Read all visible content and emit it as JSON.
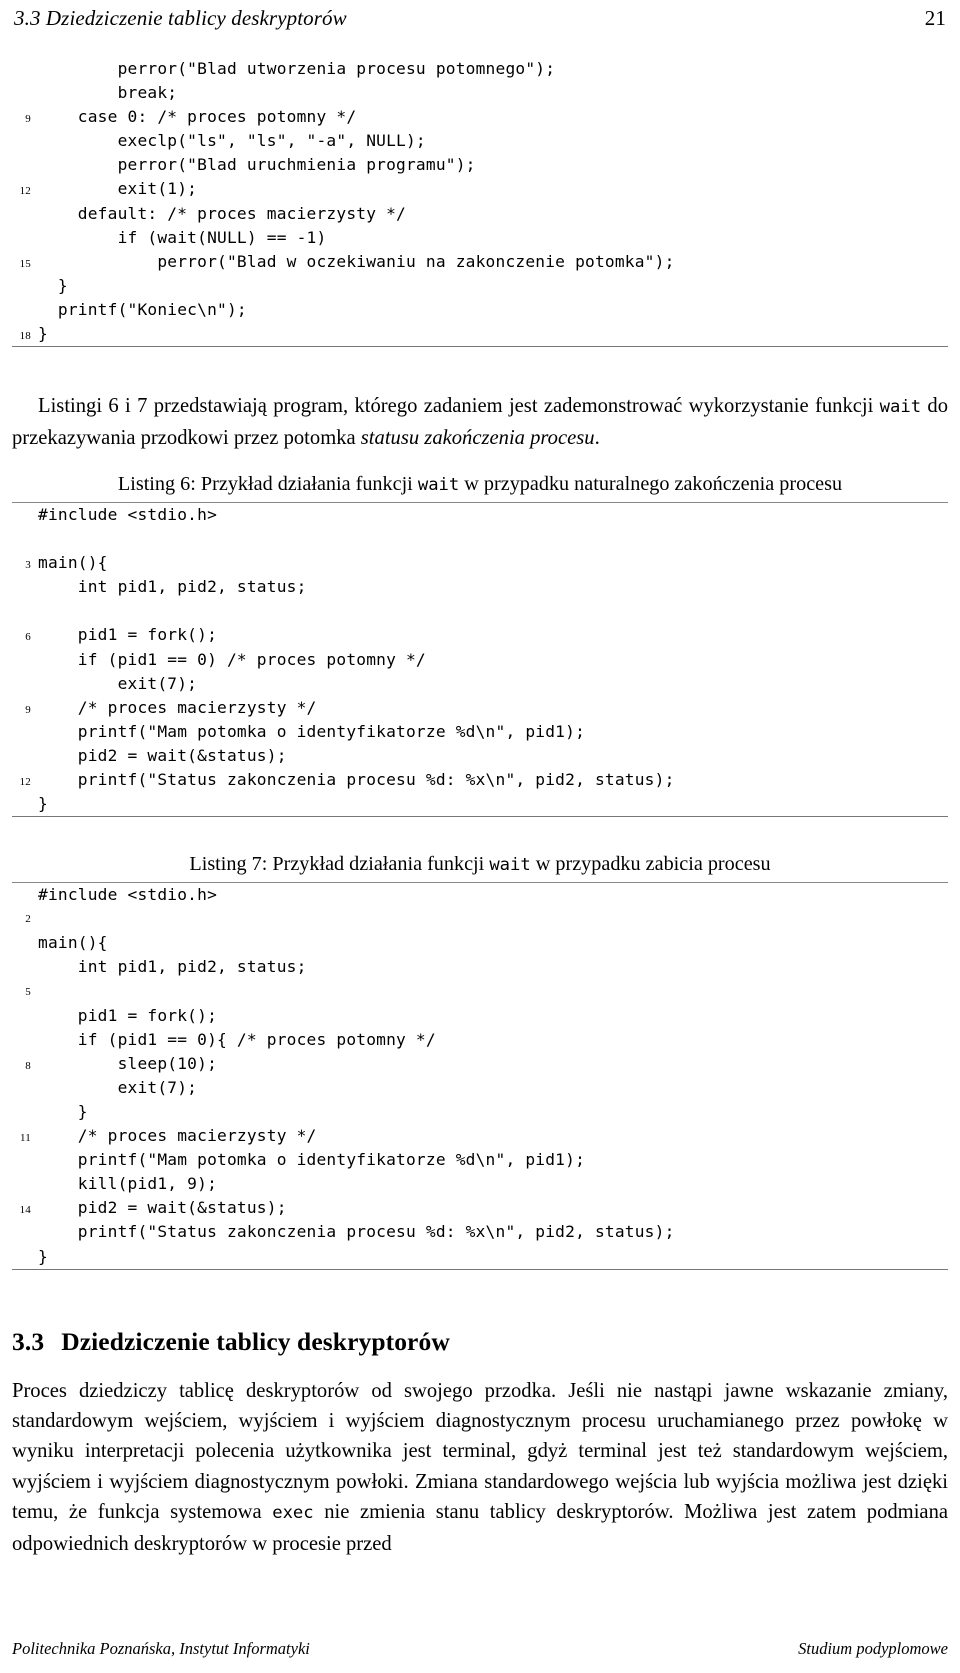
{
  "header": {
    "section_title": "3.3 Dziedziczenie tablicy deskryptorów",
    "page_number": "21"
  },
  "listing_top": {
    "lines": [
      {
        "num": "",
        "code": "        perror(\"Blad utworzenia procesu potomnego\");"
      },
      {
        "num": "",
        "code": "        break;"
      },
      {
        "num": "9",
        "code": "    case 0: /* proces potomny */"
      },
      {
        "num": "",
        "code": "        execlp(\"ls\", \"ls\", \"-a\", NULL);"
      },
      {
        "num": "",
        "code": "        perror(\"Blad uruchmienia programu\");"
      },
      {
        "num": "12",
        "code": "        exit(1);"
      },
      {
        "num": "",
        "code": "    default: /* proces macierzysty */"
      },
      {
        "num": "",
        "code": "        if (wait(NULL) == -1)"
      },
      {
        "num": "15",
        "code": "            perror(\"Blad w oczekiwaniu na zakonczenie potomka\");"
      },
      {
        "num": "",
        "code": "  }"
      },
      {
        "num": "",
        "code": "  printf(\"Koniec\\n\");"
      },
      {
        "num": "18",
        "code": "}"
      }
    ]
  },
  "paragraph_intro": {
    "part1": "Listingi 6 i 7 przedstawiają program, którego zadaniem jest zademonstrować wykorzystanie funkcji ",
    "code1": "wait",
    "part2": " do przekazywania przodkowi przez potomka ",
    "italic1": "statusu zakończenia procesu",
    "part3": "."
  },
  "listing6": {
    "caption": {
      "part1": "Listing 6: Przykład działania funkcji ",
      "code1": "wait",
      "part2": " w przypadku naturalnego zakończenia procesu"
    },
    "lines": [
      {
        "num": "",
        "code": "#include <stdio.h>"
      },
      {
        "num": "",
        "code": ""
      },
      {
        "num": "3",
        "code": "main(){"
      },
      {
        "num": "",
        "code": "    int pid1, pid2, status;"
      },
      {
        "num": "",
        "code": ""
      },
      {
        "num": "6",
        "code": "    pid1 = fork();"
      },
      {
        "num": "",
        "code": "    if (pid1 == 0) /* proces potomny */"
      },
      {
        "num": "",
        "code": "        exit(7);"
      },
      {
        "num": "9",
        "code": "    /* proces macierzysty */"
      },
      {
        "num": "",
        "code": "    printf(\"Mam potomka o identyfikatorze %d\\n\", pid1);"
      },
      {
        "num": "",
        "code": "    pid2 = wait(&status);"
      },
      {
        "num": "12",
        "code": "    printf(\"Status zakonczenia procesu %d: %x\\n\", pid2, status);"
      },
      {
        "num": "",
        "code": "}"
      }
    ]
  },
  "listing7": {
    "caption": {
      "part1": "Listing 7: Przykład działania funkcji ",
      "code1": "wait",
      "part2": " w przypadku zabicia procesu"
    },
    "lines": [
      {
        "num": "",
        "code": "#include <stdio.h>"
      },
      {
        "num": "2",
        "code": ""
      },
      {
        "num": "",
        "code": "main(){"
      },
      {
        "num": "",
        "code": "    int pid1, pid2, status;"
      },
      {
        "num": "5",
        "code": ""
      },
      {
        "num": "",
        "code": "    pid1 = fork();"
      },
      {
        "num": "",
        "code": "    if (pid1 == 0){ /* proces potomny */"
      },
      {
        "num": "8",
        "code": "        sleep(10);"
      },
      {
        "num": "",
        "code": "        exit(7);"
      },
      {
        "num": "",
        "code": "    }"
      },
      {
        "num": "11",
        "code": "    /* proces macierzysty */"
      },
      {
        "num": "",
        "code": "    printf(\"Mam potomka o identyfikatorze %d\\n\", pid1);"
      },
      {
        "num": "",
        "code": "    kill(pid1, 9);"
      },
      {
        "num": "14",
        "code": "    pid2 = wait(&status);"
      },
      {
        "num": "",
        "code": "    printf(\"Status zakonczenia procesu %d: %x\\n\", pid2, status);"
      },
      {
        "num": "",
        "code": "}"
      }
    ]
  },
  "section": {
    "number": "3.3",
    "title": "Dziedziczenie tablicy deskryptorów"
  },
  "paragraph_body": {
    "part1": "Proces dziedziczy tablicę deskryptorów od swojego przodka. Jeśli nie nastąpi jawne wskazanie zmiany, standardowym wejściem, wyjściem i wyjściem diagnostycznym procesu uruchamianego przez powłokę w wyniku interpretacji polecenia użytkownika jest terminal, gdyż terminal jest też standardowym wejściem, wyjściem i wyjściem diagnostycznym powłoki. Zmiana standardowego wejścia lub wyjścia możliwa jest dzięki temu, że funkcja systemowa ",
    "code1": "exec",
    "part2": " nie zmienia stanu tablicy deskryptorów. Możliwa jest zatem podmiana odpowiednich deskryptorów w procesie przed"
  },
  "footer": {
    "left": "Politechnika Poznańska, Instytut Informatyki",
    "right": "Studium podyplomowe"
  }
}
